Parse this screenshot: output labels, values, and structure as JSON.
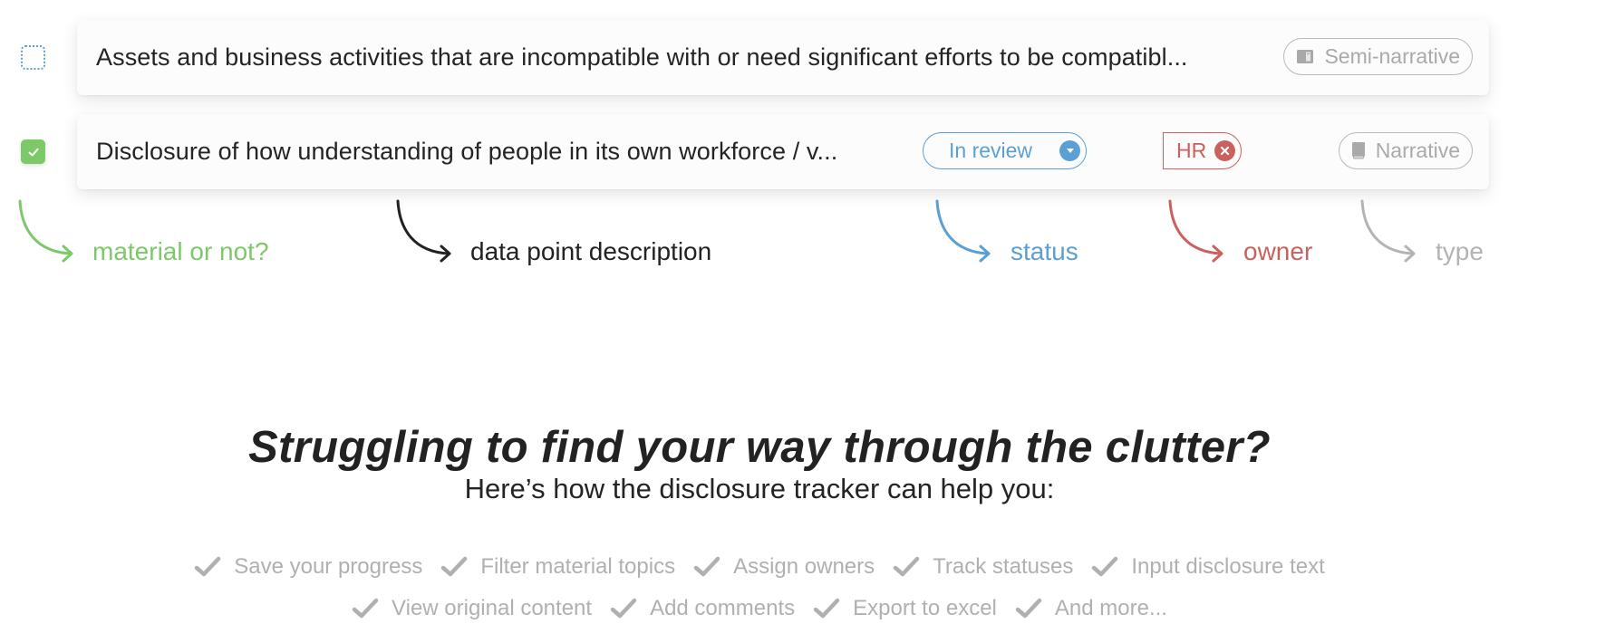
{
  "rows": [
    {
      "checked": false,
      "description": "Assets and business activities that are incompatible with or need significant efforts to be compatibl...",
      "type": "Semi-narrative",
      "type_icon": "half-book-icon"
    },
    {
      "checked": true,
      "description": "Disclosure of how understanding of people in its own workforce / v...",
      "status": "In review",
      "status_icon": "chevron-down-icon",
      "owner": "HR",
      "owner_icon": "close-icon",
      "type": "Narrative",
      "type_icon": "book-icon"
    }
  ],
  "annotations": {
    "material": "material or not?",
    "description": "data point description",
    "status": "status",
    "owner": "owner",
    "type": "type"
  },
  "colors": {
    "material": "#7cc96a",
    "status": "#5b9fd4",
    "owner": "#c9615e",
    "type": "#b3b3b3",
    "text": "#222222"
  },
  "headline": "Struggling to find your way through the clutter?",
  "subheadline": "Here’s how the disclosure tracker can help you:",
  "features_row1": [
    "Save your progress",
    "Filter material topics",
    "Assign owners",
    "Track statuses",
    "Input disclosure text"
  ],
  "features_row2": [
    "View original content",
    "Add comments",
    "Export to excel",
    "And more..."
  ]
}
